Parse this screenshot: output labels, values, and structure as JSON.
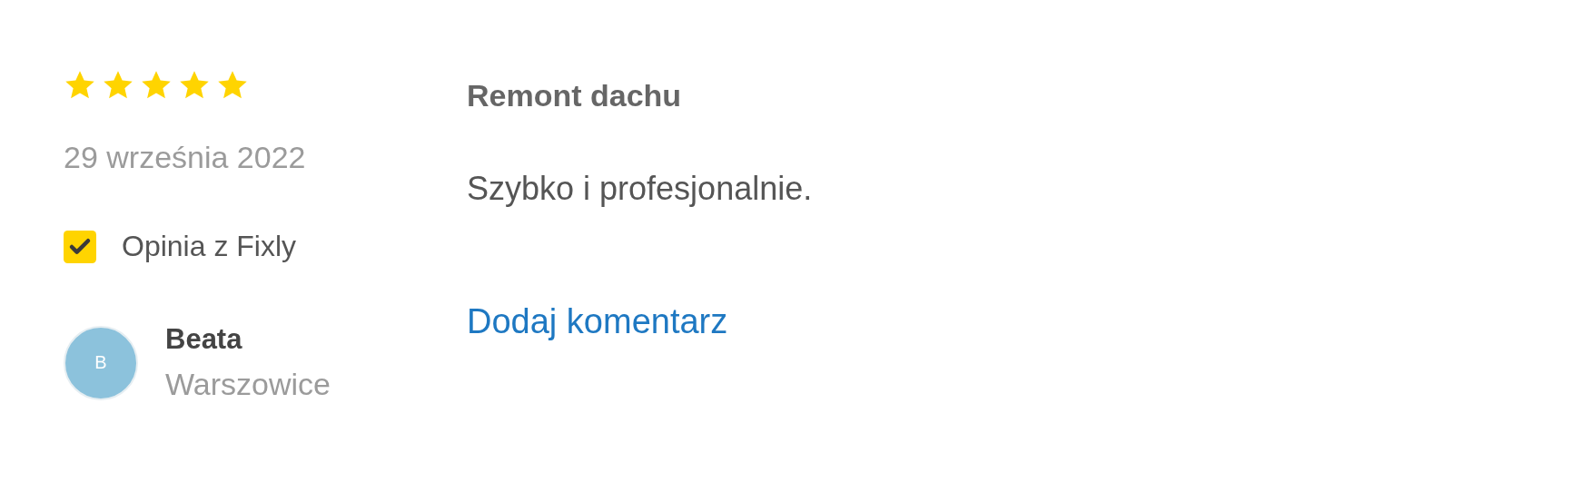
{
  "review": {
    "stars": 5,
    "date": "29 września 2022",
    "source": {
      "checked": true,
      "label": "Opinia z Fixly"
    },
    "author": {
      "initial": "B",
      "name": "Beata",
      "location": "Warszowice"
    },
    "title": "Remont dachu",
    "text": "Szybko i profesjonalnie.",
    "comment_link": "Dodaj komentarz"
  }
}
